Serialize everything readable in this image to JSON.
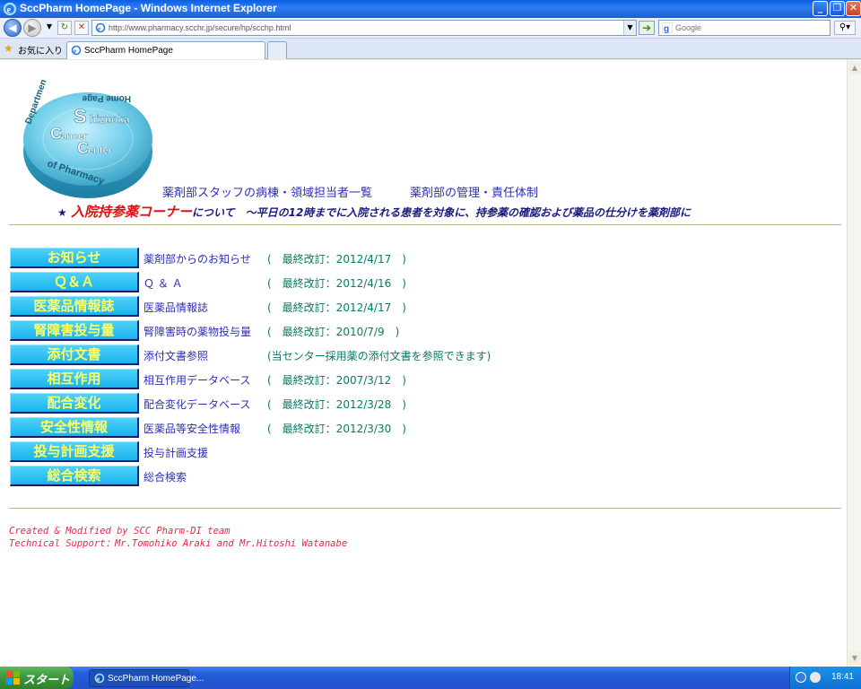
{
  "window": {
    "title": "SccPharm HomePage - Windows Internet Explorer"
  },
  "address": {
    "url": "http://www.pharmacy.scchr.jp/secure/hp/scchp.html",
    "search_placeholder": "Google"
  },
  "favorites": {
    "label": "お気に入り"
  },
  "tab": {
    "label": "SccPharm HomePage"
  },
  "page": {
    "logo_alt": "Shizuoka Cancer Center Department of Pharmacy Home Page",
    "top_links": [
      {
        "label": "薬剤部スタッフの病棟・領域担当者一覧"
      },
      {
        "label": "薬剤部の管理・責任体制"
      }
    ],
    "notice": {
      "star": "★",
      "highlight": "入院持参薬コーナー",
      "text": "について　～平日の12時までに入院される患者を対象に、持参薬の確認および薬品の仕分けを薬剤部に"
    },
    "menu": [
      {
        "button": "お知らせ",
        "link": "薬剤部からのお知らせ",
        "date": "(　最終改訂：2012/4/17　)"
      },
      {
        "button": "Ｑ＆Ａ",
        "link": "Ｑ ＆ Ａ",
        "date": "(　最終改訂：2012/4/16　)"
      },
      {
        "button": "医薬品情報誌",
        "link": "医薬品情報誌",
        "date": "(　最終改訂：2012/4/17　)"
      },
      {
        "button": "腎障害投与量",
        "link": "腎障害時の薬物投与量",
        "date": "(　最終改訂：2010/7/9　)"
      },
      {
        "button": "添付文書",
        "link": "添付文書参照",
        "date": "(当センター採用薬の添付文書を参照できます)"
      },
      {
        "button": "相互作用",
        "link": "相互作用データベース",
        "date": "(　最終改訂：2007/3/12　)"
      },
      {
        "button": "配合変化",
        "link": "配合変化データベース",
        "date": "(　最終改訂：2012/3/28　)"
      },
      {
        "button": "安全性情報",
        "link": "医薬品等安全性情報",
        "date": "(　最終改訂：2012/3/30　)"
      },
      {
        "button": "投与計画支援",
        "link": "投与計画支援",
        "date": ""
      },
      {
        "button": "総合検索",
        "link": "総合検索",
        "date": ""
      }
    ],
    "credits": [
      "Created & Modified by SCC Pharm-DI team",
      "Technical Support：Mr.Tomohiko Araki and Mr.Hitoshi Watanabe"
    ]
  },
  "taskbar": {
    "start_label": "スタート",
    "task_label": "SccPharm HomePage...",
    "clock": "18:41"
  },
  "colors": {
    "menu_button_bg": "#19B3EE",
    "menu_button_text": "#FFFF66",
    "link": "#2E2EB8",
    "date": "#0A7A64",
    "notice_red": "#E01010",
    "credits": "#E8284A"
  }
}
